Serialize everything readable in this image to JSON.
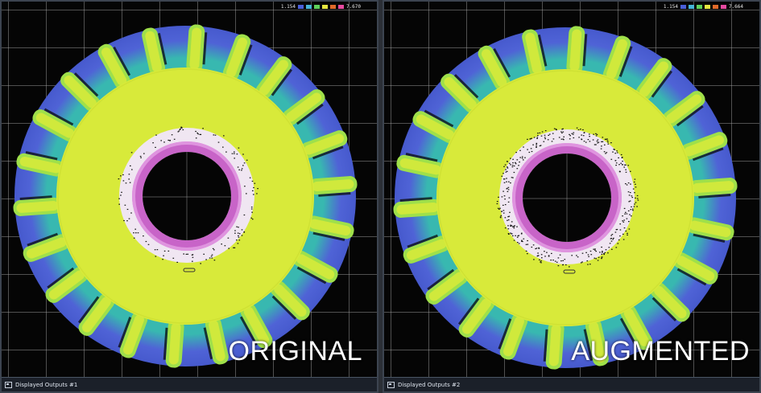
{
  "panes": [
    {
      "label": "ORIGINAL",
      "tab_title": "Displayed Outputs #1",
      "scale": {
        "min": "1.154",
        "max": "7.670"
      }
    },
    {
      "label": "AUGMENTED",
      "tab_title": "Displayed Outputs #2",
      "scale": {
        "min": "1.154",
        "max": "7.664"
      }
    }
  ],
  "colors": {
    "face": "#d8ea3a",
    "teeth_outer": "#4f63d6",
    "teeth_mid": "#38b8b0",
    "ring": "#c864c8",
    "ring_inner": "#f0e6f2",
    "background": "#050505"
  },
  "scale_swatches": [
    "#4a5fd8",
    "#46b4d6",
    "#5fd05a",
    "#e6e640",
    "#e06a2a",
    "#e64aa0"
  ]
}
